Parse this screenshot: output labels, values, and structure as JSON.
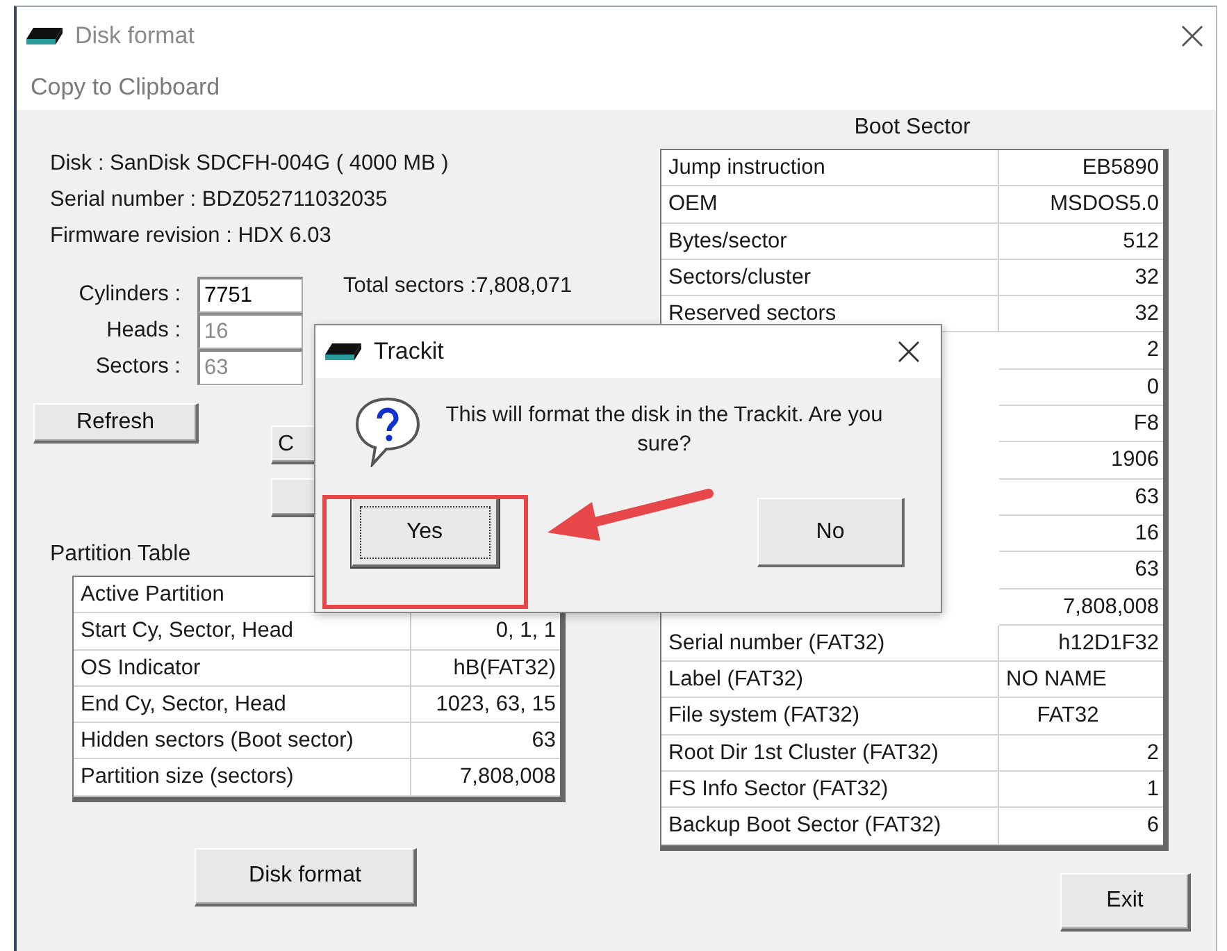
{
  "window": {
    "title": "Disk format",
    "active": false
  },
  "menu": [
    "Copy to Clipboard"
  ],
  "disk_info": [
    "Disk : SanDisk SDCFH-004G ( 4000 MB )",
    "Serial number : BDZ052711032035",
    "Firmware revision : HDX 6.03"
  ],
  "geometry": [
    {
      "label": "Cylinders :",
      "value": "7751",
      "disabled": false
    },
    {
      "label": "Heads :",
      "value": "16",
      "disabled": true
    },
    {
      "label": "Sectors :",
      "value": "63",
      "disabled": true
    }
  ],
  "total_sectors": "Total sectors :7,808,071",
  "refresh_button": "Refresh",
  "side_buttons": [
    {
      "label": "C"
    }
  ],
  "partition_table": {
    "title": "Partition Table",
    "rows": [
      {
        "label": "Active Partition"
      },
      {
        "label": "Start Cy, Sector, Head",
        "value": "0, 1, 1"
      },
      {
        "label": "OS Indicator",
        "value": "hB(FAT32)"
      },
      {
        "label": "End Cy, Sector, Head",
        "value": "1023, 63, 15"
      },
      {
        "label": "Hidden sectors (Boot sector)",
        "value": "63"
      },
      {
        "label": "Partition size (sectors)",
        "value": "7,808,008"
      }
    ]
  },
  "format_button": "Disk format",
  "boot_sector": {
    "title": "Boot Sector",
    "rows": [
      {
        "label": "Jump instruction",
        "value": "EB5890"
      },
      {
        "label": "OEM",
        "value": "MSDOS5.0"
      },
      {
        "label": "Bytes/sector",
        "value": "512"
      },
      {
        "label": "Sectors/cluster",
        "value": "32"
      },
      {
        "label": "Reserved sectors",
        "value": "32"
      },
      {
        "value": "2"
      },
      {
        "value": "0"
      },
      {
        "value": "F8"
      },
      {
        "value": "1906"
      },
      {
        "value": "63"
      },
      {
        "value": "16"
      },
      {
        "value": "63"
      },
      {
        "value": "7,808,008"
      },
      {
        "label": "Serial number (FAT32)",
        "value": "h12D1F32"
      },
      {
        "label": "Label (FAT32)",
        "value": "NO NAME",
        "kind": "left"
      },
      {
        "label": "File system (FAT32)",
        "value": "FAT32",
        "kind": "center"
      },
      {
        "label": "Root Dir 1st Cluster (FAT32)",
        "value": "2"
      },
      {
        "label": "FS Info Sector (FAT32)",
        "value": "1"
      },
      {
        "label": "Backup Boot Sector (FAT32)",
        "value": "6"
      }
    ]
  },
  "exit_button": "Exit",
  "dialog": {
    "title": "Trackit",
    "message": "This will format the disk in the Trackit. Are you sure?",
    "buttons": [
      {
        "label": "Yes",
        "focused": true,
        "highlighted": true
      },
      {
        "label": "No",
        "focused": false,
        "highlighted": false
      }
    ]
  }
}
